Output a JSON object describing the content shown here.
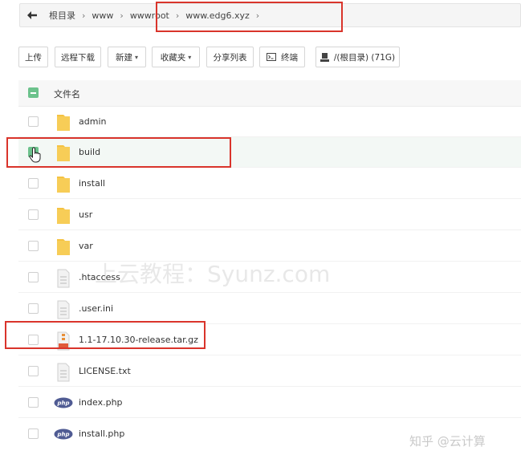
{
  "breadcrumb": {
    "items": [
      "根目录",
      "www",
      "wwwroot",
      "www.edg6.xyz"
    ]
  },
  "toolbar": {
    "upload": "上传",
    "remote_download": "远程下载",
    "new": "新建",
    "favorites": "收藏夹",
    "share_list": "分享列表",
    "terminal": "终端",
    "disk": "/(根目录) (71G)"
  },
  "table": {
    "column_filename": "文件名"
  },
  "files": [
    {
      "name": "admin",
      "type": "folder"
    },
    {
      "name": "build",
      "type": "folder"
    },
    {
      "name": "install",
      "type": "folder"
    },
    {
      "name": "usr",
      "type": "folder"
    },
    {
      "name": "var",
      "type": "folder"
    },
    {
      "name": ".htaccess",
      "type": "file"
    },
    {
      "name": ".user.ini",
      "type": "file"
    },
    {
      "name": "1.1-17.10.30-release.tar.gz",
      "type": "archive"
    },
    {
      "name": "LICENSE.txt",
      "type": "file"
    },
    {
      "name": "index.php",
      "type": "php"
    },
    {
      "name": "install.php",
      "type": "php"
    }
  ],
  "icons": {
    "php_label": "php"
  },
  "overlay": {
    "watermark": "上云教程：Syunz.com",
    "credit": "知乎 @云计算"
  },
  "colors": {
    "accent_green": "#6cc28c",
    "folder_yellow": "#f5c242",
    "annotation_red": "#d9342b"
  }
}
